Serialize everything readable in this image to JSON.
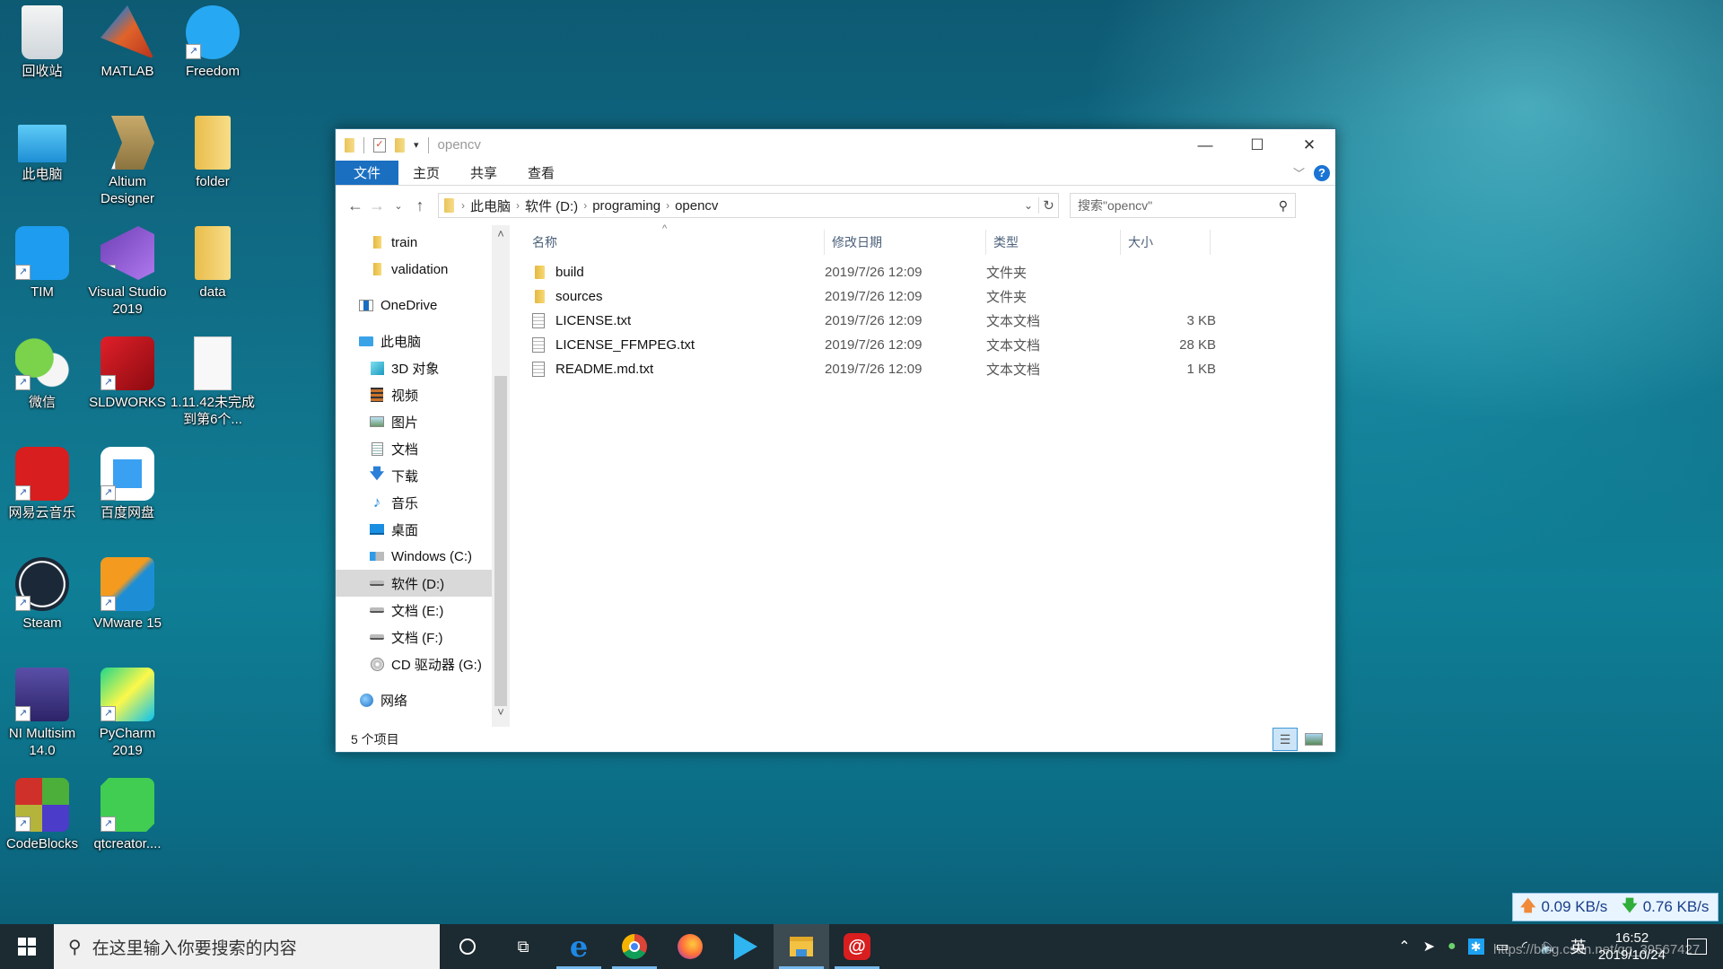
{
  "desktop": {
    "icons": [
      {
        "label": "回收站",
        "icon": "recycle-bin-icon",
        "shortcut": false
      },
      {
        "label": "MATLAB",
        "icon": "matlab-icon",
        "shortcut": true
      },
      {
        "label": "Freedom",
        "icon": "freedom-icon",
        "shortcut": true
      },
      {
        "label": "此电脑",
        "icon": "this-pc-icon",
        "shortcut": false
      },
      {
        "label": "Altium Designer",
        "icon": "altium-icon",
        "shortcut": true
      },
      {
        "label": "folder",
        "icon": "folder-icon",
        "shortcut": false
      },
      {
        "label": "TIM",
        "icon": "tim-icon",
        "shortcut": true
      },
      {
        "label": "Visual Studio 2019",
        "icon": "visual-studio-icon",
        "shortcut": true
      },
      {
        "label": "data",
        "icon": "folder-icon",
        "shortcut": false
      },
      {
        "label": "微信",
        "icon": "wechat-icon",
        "shortcut": true
      },
      {
        "label": "SLDWORKS",
        "icon": "solidworks-icon",
        "shortcut": true
      },
      {
        "label": "1.11.42未完成到第6个...",
        "icon": "text-file-icon",
        "shortcut": false
      },
      {
        "label": "网易云音乐",
        "icon": "netease-music-icon",
        "shortcut": true
      },
      {
        "label": "百度网盘",
        "icon": "baidu-netdisk-icon",
        "shortcut": true
      },
      {
        "label": "Steam",
        "icon": "steam-icon",
        "shortcut": true
      },
      {
        "label": "VMware 15",
        "icon": "vmware-icon",
        "shortcut": true
      },
      {
        "label": "NI Multisim 14.0",
        "icon": "multisim-icon",
        "shortcut": true
      },
      {
        "label": "PyCharm 2019",
        "icon": "pycharm-icon",
        "shortcut": true
      },
      {
        "label": "CodeBlocks",
        "icon": "codeblocks-icon",
        "shortcut": true
      },
      {
        "label": "qtcreator....",
        "icon": "qtcreator-icon",
        "shortcut": true
      }
    ]
  },
  "explorer": {
    "title": "opencv",
    "ribbon_tabs": [
      "文件",
      "主页",
      "共享",
      "查看"
    ],
    "window_buttons": {
      "minimize": "—",
      "maximize": "☐",
      "close": "✕"
    },
    "address": {
      "crumbs": [
        "此电脑",
        "软件 (D:)",
        "programing",
        "opencv"
      ]
    },
    "search_placeholder": "搜索\"opencv\"",
    "nav_items": [
      {
        "label": "train",
        "icon": "folder-icon",
        "indent": 2
      },
      {
        "label": "validation",
        "icon": "folder-icon",
        "indent": 2
      },
      {
        "label": "OneDrive",
        "icon": "onedrive-icon",
        "indent": 1
      },
      {
        "label": "此电脑",
        "icon": "this-pc-icon",
        "indent": 1
      },
      {
        "label": "3D 对象",
        "icon": "3d-objects-icon",
        "indent": 2
      },
      {
        "label": "视频",
        "icon": "videos-icon",
        "indent": 2
      },
      {
        "label": "图片",
        "icon": "pictures-icon",
        "indent": 2
      },
      {
        "label": "文档",
        "icon": "documents-icon",
        "indent": 2
      },
      {
        "label": "下载",
        "icon": "downloads-icon",
        "indent": 2
      },
      {
        "label": "音乐",
        "icon": "music-icon",
        "indent": 2
      },
      {
        "label": "桌面",
        "icon": "desktop-icon",
        "indent": 2
      },
      {
        "label": "Windows (C:)",
        "icon": "windows-drive-icon",
        "indent": 2
      },
      {
        "label": "软件 (D:)",
        "icon": "drive-icon",
        "indent": 2,
        "selected": true
      },
      {
        "label": "文档 (E:)",
        "icon": "drive-icon",
        "indent": 2
      },
      {
        "label": "文档 (F:)",
        "icon": "drive-icon",
        "indent": 2
      },
      {
        "label": "CD 驱动器 (G:)",
        "icon": "cd-drive-icon",
        "indent": 2
      },
      {
        "label": "网络",
        "icon": "network-icon",
        "indent": 1
      }
    ],
    "columns": [
      "名称",
      "修改日期",
      "类型",
      "大小"
    ],
    "files": [
      {
        "name": "build",
        "date": "2019/7/26 12:09",
        "type": "文件夹",
        "size": "",
        "kind": "folder"
      },
      {
        "name": "sources",
        "date": "2019/7/26 12:09",
        "type": "文件夹",
        "size": "",
        "kind": "folder"
      },
      {
        "name": "LICENSE.txt",
        "date": "2019/7/26 12:09",
        "type": "文本文档",
        "size": "3 KB",
        "kind": "txt"
      },
      {
        "name": "LICENSE_FFMPEG.txt",
        "date": "2019/7/26 12:09",
        "type": "文本文档",
        "size": "28 KB",
        "kind": "txt"
      },
      {
        "name": "README.md.txt",
        "date": "2019/7/26 12:09",
        "type": "文本文档",
        "size": "1 KB",
        "kind": "txt"
      }
    ],
    "status": "5 个项目"
  },
  "netspeed": {
    "up": "0.09 KB/s",
    "down": "0.76 KB/s"
  },
  "taskbar": {
    "search_placeholder": "在这里输入你要搜索的内容",
    "apps": [
      "cortana",
      "task-view",
      "edge",
      "chrome",
      "firefox",
      "tencent-video",
      "file-explorer",
      "netease-music"
    ],
    "ime": "英",
    "time": "16:52",
    "date": "2019/10/24"
  },
  "watermark": "https://blog.csdn.net/qq_39567427"
}
